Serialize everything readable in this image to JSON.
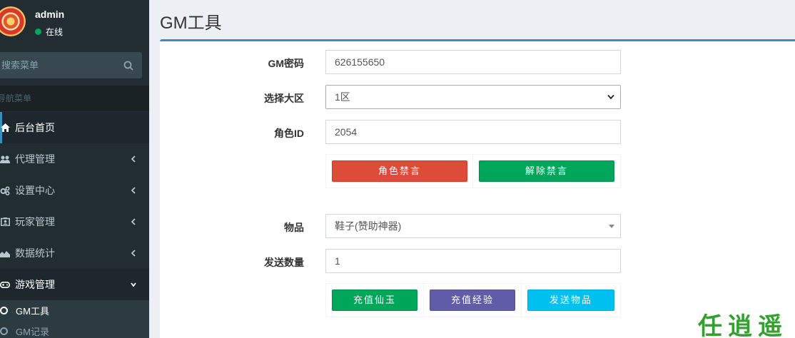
{
  "sidebar": {
    "user": {
      "name": "admin",
      "status": "在线"
    },
    "search": {
      "placeholder": "搜索菜单"
    },
    "nav_header": "导航菜单",
    "items": [
      {
        "label": "后台首页",
        "icon": "home-icon"
      },
      {
        "label": "代理管理",
        "icon": "users-icon"
      },
      {
        "label": "设置中心",
        "icon": "gears-icon"
      },
      {
        "label": "玩家管理",
        "icon": "address-card-icon"
      },
      {
        "label": "数据统计",
        "icon": "area-chart-icon"
      },
      {
        "label": "游戏管理",
        "icon": "gamepad-icon"
      }
    ],
    "subitems": [
      {
        "label": "GM工具"
      },
      {
        "label": "GM记录"
      }
    ]
  },
  "header": {
    "title": "GM工具"
  },
  "form": {
    "gm_password": {
      "label": "GM密码",
      "value": "626155650"
    },
    "server": {
      "label": "选择大区",
      "value": "1区",
      "options": [
        "1区"
      ]
    },
    "role_id": {
      "label": "角色ID",
      "value": "2054"
    },
    "mute_label": "角色禁言",
    "unmute_label": "解除禁言",
    "item": {
      "label": "物品",
      "value": "鞋子(赞助神器)"
    },
    "quantity": {
      "label": "发送数量",
      "value": "1"
    },
    "recharge_jade_label": "充值仙玉",
    "recharge_exp_label": "充值经验",
    "send_item_label": "发送物品"
  },
  "watermark": "任逍遥",
  "colors": {
    "sidebar_bg": "#222d32",
    "accent": "#3c8dbc",
    "danger": "#dd4b39",
    "success": "#00a65a",
    "purple": "#605ca8",
    "info": "#00c0ef"
  }
}
